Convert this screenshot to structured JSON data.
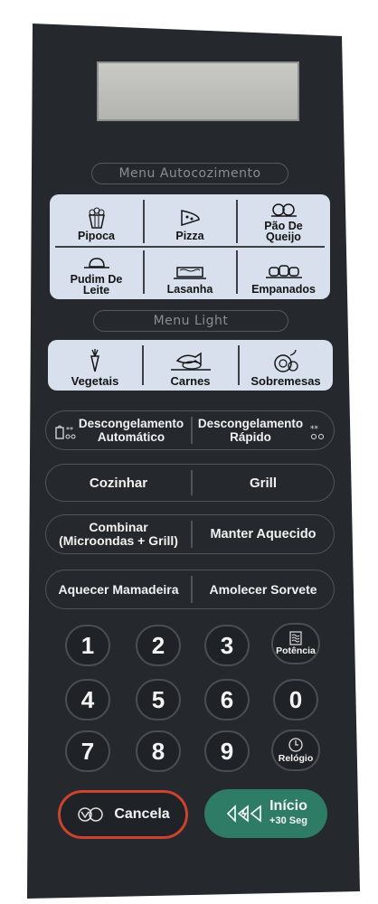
{
  "sections": {
    "auto_menu": "Menu Autocozimento",
    "light_menu": "Menu Light"
  },
  "auto_menu_items": [
    {
      "label": "Pipoca",
      "icon": "popcorn-icon"
    },
    {
      "label": "Pizza",
      "icon": "pizza-slice-icon"
    },
    {
      "label": "Pão De\nQueijo",
      "icon": "cheese-bread-icon"
    },
    {
      "label": "Pudim De\nLeite",
      "icon": "pudding-icon"
    },
    {
      "label": "Lasanha",
      "icon": "lasagna-icon"
    },
    {
      "label": "Empanados",
      "icon": "breaded-food-icon"
    }
  ],
  "light_menu_items": [
    {
      "label": "Vegetais",
      "icon": "carrot-icon"
    },
    {
      "label": "Carnes",
      "icon": "fish-meat-icon"
    },
    {
      "label": "Sobremesas",
      "icon": "dessert-icon"
    }
  ],
  "function_rows": [
    {
      "left": "Descongelamento\nAutomático",
      "right": "Descongelamento\nRápido"
    },
    {
      "left": "Cozinhar",
      "right": "Grill"
    },
    {
      "left": "Combinar\n(Microondas + Grill)",
      "right": "Manter Aquecido"
    },
    {
      "left": "Aquecer Mamadeira",
      "right": "Amolecer Sorvete"
    }
  ],
  "keypad": {
    "k1": "1",
    "k2": "2",
    "k3": "3",
    "k4": "4",
    "k5": "5",
    "k6": "6",
    "k0": "0",
    "k7": "7",
    "k8": "8",
    "k9": "9",
    "power": "Potência",
    "clock": "Relógio"
  },
  "cancel_label": "Cancela",
  "start_label": "Início",
  "start_sub": "+30 Seg",
  "colors": {
    "panel": "#25282c",
    "menu_box": "#d7e0ec",
    "cancel_ring": "#c9432f",
    "start_green": "#2e7b66"
  }
}
